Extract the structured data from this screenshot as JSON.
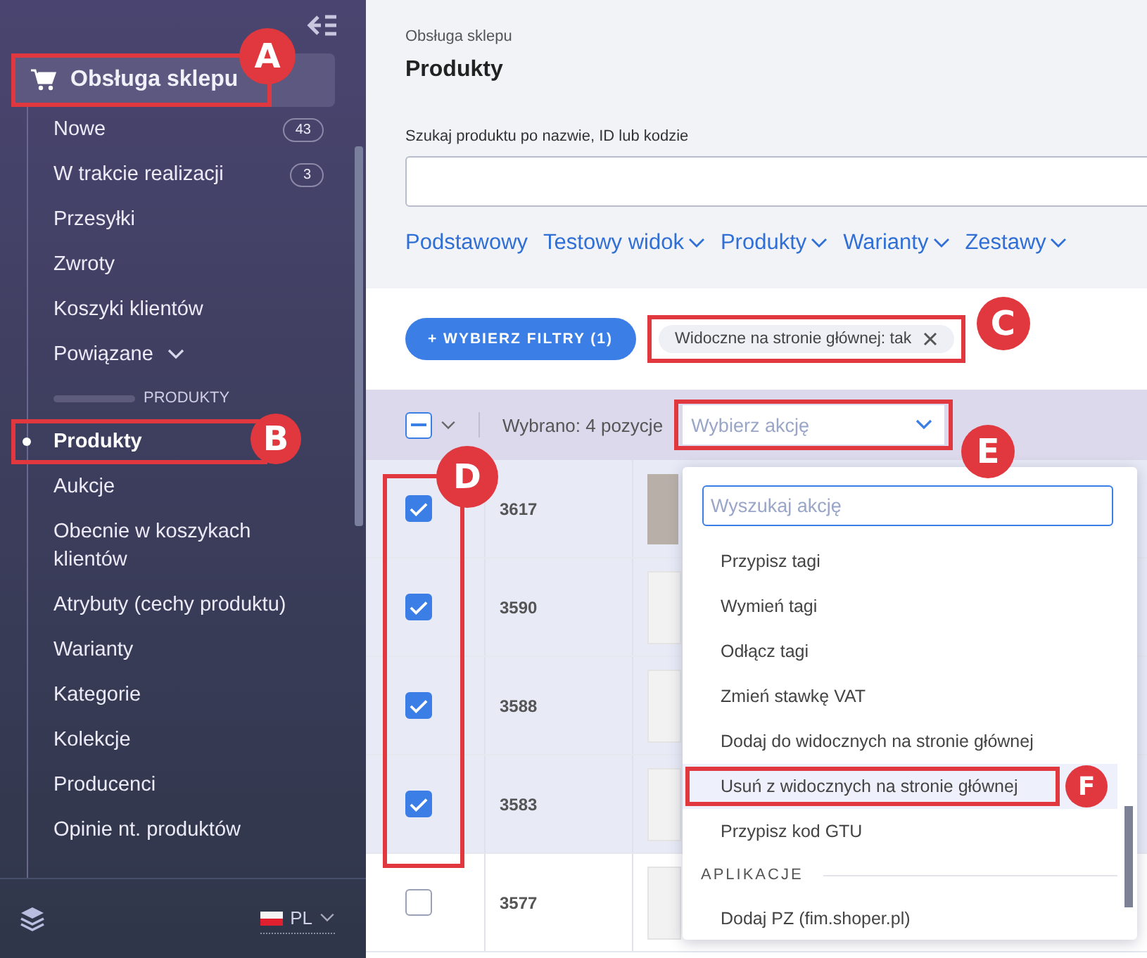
{
  "sidebar": {
    "header": {
      "label": "Obsługa sklepu",
      "marker": "A"
    },
    "items": [
      {
        "kind": "link",
        "label": "Nowe",
        "badge": "43",
        "selected": false
      },
      {
        "kind": "link",
        "label": "W trakcie realizacji",
        "badge": "3",
        "selected": false
      },
      {
        "kind": "link",
        "label": "Przesyłki",
        "selected": false
      },
      {
        "kind": "link",
        "label": "Zwroty",
        "selected": false
      },
      {
        "kind": "link",
        "label": "Koszyki klientów",
        "selected": false
      },
      {
        "kind": "group",
        "label": "Powiązane"
      },
      {
        "kind": "section",
        "label": "PRODUKTY"
      },
      {
        "kind": "link",
        "label": "Produkty",
        "selected": true,
        "marker": "B"
      },
      {
        "kind": "link",
        "label": "Aukcje",
        "selected": false
      },
      {
        "kind": "link",
        "label": "Obecnie w koszykach klientów",
        "selected": false
      },
      {
        "kind": "link",
        "label": "Atrybuty (cechy produktu)",
        "selected": false
      },
      {
        "kind": "link",
        "label": "Warianty",
        "selected": false
      },
      {
        "kind": "link",
        "label": "Kategorie",
        "selected": false
      },
      {
        "kind": "link",
        "label": "Kolekcje",
        "selected": false
      },
      {
        "kind": "link",
        "label": "Producenci",
        "selected": false
      },
      {
        "kind": "link",
        "label": "Opinie nt. produktów",
        "selected": false
      }
    ],
    "language": "PL"
  },
  "main": {
    "breadcrumb": "Obsługa sklepu",
    "title": "Produkty",
    "search": {
      "label": "Szukaj produktu po nazwie, ID lub kodzie"
    },
    "tabs": [
      {
        "label": "Podstawowy",
        "dropdown": false
      },
      {
        "label": "Testowy widok",
        "dropdown": true
      },
      {
        "label": "Produkty",
        "dropdown": true
      },
      {
        "label": "Warianty",
        "dropdown": true
      },
      {
        "label": "Zestawy",
        "dropdown": true
      }
    ],
    "filter_button": "+ WYBIERZ FILTRY (1)",
    "filter_chips": [
      {
        "label": "Widoczne na stronie głównej: tak",
        "marker": "C"
      }
    ],
    "bulk": {
      "partial": true,
      "summary": "Wybrano: 4 pozycje",
      "action_placeholder": "Wybierz akcję",
      "marker": "E"
    },
    "table": {
      "selection_marker": "D",
      "rows": [
        {
          "id": "3617",
          "checked": true,
          "kind": "photo"
        },
        {
          "id": "3590",
          "checked": true,
          "kind": "thumbnail"
        },
        {
          "id": "3588",
          "checked": true,
          "kind": "thumbnail"
        },
        {
          "id": "3583",
          "checked": true,
          "kind": "thumbnail"
        },
        {
          "id": "3577",
          "checked": false,
          "kind": "thumbnail"
        }
      ]
    },
    "action_menu": {
      "search_placeholder": "Wyszukaj akcję",
      "items": [
        {
          "kind": "action",
          "label": "Przypisz tagi",
          "selected": false
        },
        {
          "kind": "action",
          "label": "Wymień tagi",
          "selected": false
        },
        {
          "kind": "action",
          "label": "Odłącz tagi",
          "selected": false
        },
        {
          "kind": "action",
          "label": "Zmień stawkę VAT",
          "selected": false
        },
        {
          "kind": "action",
          "label": "Dodaj do widocznych na stronie głównej",
          "selected": false
        },
        {
          "kind": "action",
          "label": "Usuń z widocznych na stronie głównej",
          "selected": true,
          "marker": "F"
        },
        {
          "kind": "action",
          "label": "Przypisz kod GTU",
          "selected": false
        },
        {
          "kind": "heading",
          "label": "APLIKACJE"
        },
        {
          "kind": "action",
          "label": "Dodaj PZ (fim.shoper.pl)",
          "selected": false
        }
      ]
    }
  }
}
